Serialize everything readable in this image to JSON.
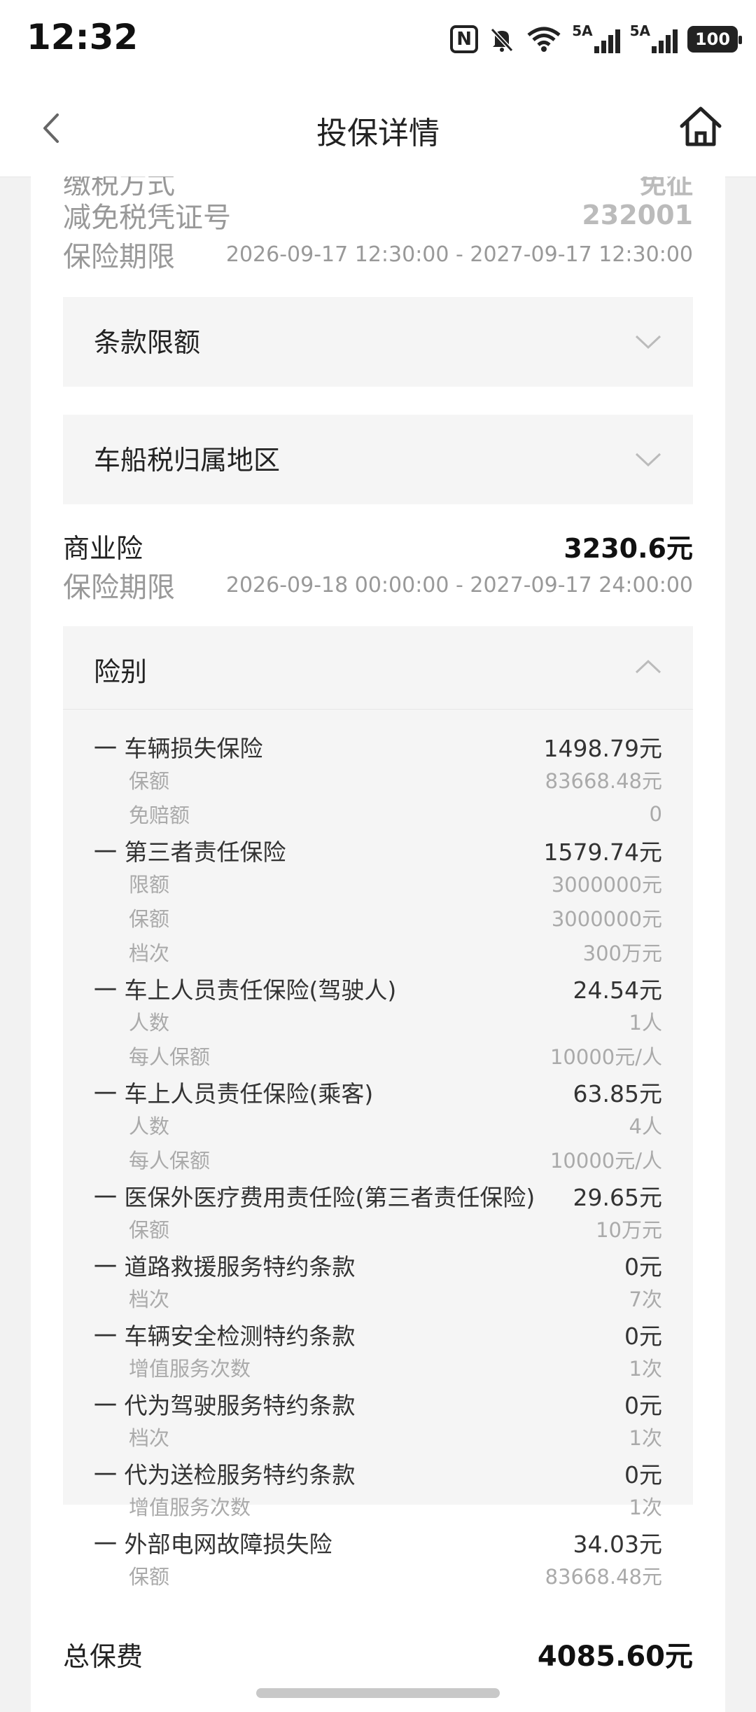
{
  "status_bar": {
    "time": "12:32",
    "battery": "100",
    "signal1_label": "5A",
    "signal2_label": "5A"
  },
  "header": {
    "title": "投保详情"
  },
  "compulsory": {
    "partial_row": {
      "label": "缴税方式",
      "value": "免征"
    },
    "exempt_cert": {
      "label": "减免税凭证号",
      "value": "232001"
    },
    "period": {
      "label": "保险期限",
      "value": "2026-09-17 12:30:00 - 2027-09-17 12:30:00"
    }
  },
  "panels": {
    "terms_limit": "条款限额",
    "vessel_tax_region": "车船税归属地区"
  },
  "commercial": {
    "label": "商业险",
    "amount": "3230.6元",
    "period": {
      "label": "保险期限",
      "value": "2026-09-18 00:00:00 - 2027-09-17 24:00:00"
    }
  },
  "coverage": {
    "header": "险别",
    "items": [
      {
        "name": "一 车辆损失保险",
        "amount": "1498.79元",
        "subs": [
          {
            "label": "保额",
            "value": "83668.48元"
          },
          {
            "label": "免赔额",
            "value": "0"
          }
        ]
      },
      {
        "name": "一 第三者责任保险",
        "amount": "1579.74元",
        "subs": [
          {
            "label": "限额",
            "value": "3000000元"
          },
          {
            "label": "保额",
            "value": "3000000元"
          },
          {
            "label": "档次",
            "value": "300万元"
          }
        ]
      },
      {
        "name": "一 车上人员责任保险(驾驶人)",
        "amount": "24.54元",
        "subs": [
          {
            "label": "人数",
            "value": "1人"
          },
          {
            "label": "每人保额",
            "value": "10000元/人"
          }
        ]
      },
      {
        "name": "一 车上人员责任保险(乘客)",
        "amount": "63.85元",
        "subs": [
          {
            "label": "人数",
            "value": "4人"
          },
          {
            "label": "每人保额",
            "value": "10000元/人"
          }
        ]
      },
      {
        "name": "一 医保外医疗费用责任险(第三者责任保险)",
        "amount": "29.65元",
        "subs": [
          {
            "label": "保额",
            "value": "10万元"
          }
        ]
      },
      {
        "name": "一 道路救援服务特约条款",
        "amount": "0元",
        "subs": [
          {
            "label": "档次",
            "value": "7次"
          }
        ]
      },
      {
        "name": "一 车辆安全检测特约条款",
        "amount": "0元",
        "subs": [
          {
            "label": "增值服务次数",
            "value": "1次"
          }
        ]
      },
      {
        "name": "一 代为驾驶服务特约条款",
        "amount": "0元",
        "subs": [
          {
            "label": "档次",
            "value": "1次"
          }
        ]
      },
      {
        "name": "一 代为送检服务特约条款",
        "amount": "0元",
        "subs": [
          {
            "label": "增值服务次数",
            "value": "1次"
          }
        ]
      },
      {
        "name": "一 外部电网故障损失险",
        "amount": "34.03元",
        "subs": [
          {
            "label": "保额",
            "value": "83668.48元"
          }
        ]
      }
    ]
  },
  "total": {
    "label": "总保费",
    "amount": "4085.60元"
  }
}
